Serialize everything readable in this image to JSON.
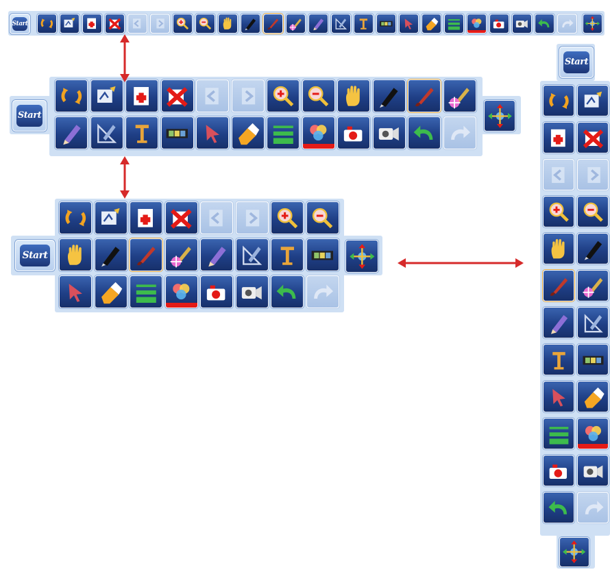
{
  "start_label": "Start",
  "colors": {
    "bar_background": "#cfe0f4",
    "button_dark": "#1f3f86",
    "button_disabled": "#b7cdeb",
    "arrow": "#d62a2a",
    "color_indicator": "#e41b17",
    "selected_border": "#e0a33a"
  },
  "tools": [
    {
      "id": "clear",
      "icon": "circular-arrows-icon"
    },
    {
      "id": "shape-recognition",
      "icon": "pen-draw-icon"
    },
    {
      "id": "new-page",
      "icon": "add-page-icon"
    },
    {
      "id": "delete-page",
      "icon": "delete-page-icon"
    },
    {
      "id": "previous-page",
      "icon": "previous-page-icon",
      "disabled": true
    },
    {
      "id": "next-page",
      "icon": "next-page-icon",
      "disabled": true
    },
    {
      "id": "zoom-in",
      "icon": "zoom-in-icon"
    },
    {
      "id": "zoom-out",
      "icon": "zoom-out-icon"
    },
    {
      "id": "pan",
      "icon": "hand-icon"
    },
    {
      "id": "pen",
      "icon": "pen-icon"
    },
    {
      "id": "brush",
      "icon": "brush-icon",
      "selected": true
    },
    {
      "id": "magic-brush",
      "icon": "magic-brush-icon"
    },
    {
      "id": "pencil",
      "icon": "pencil-icon"
    },
    {
      "id": "ruler-pen",
      "icon": "ruler-pen-icon"
    },
    {
      "id": "text",
      "icon": "text-tool-icon"
    },
    {
      "id": "screen-strip",
      "icon": "film-strip-icon"
    },
    {
      "id": "select",
      "icon": "cursor-arrow-icon"
    },
    {
      "id": "eraser",
      "icon": "eraser-icon"
    },
    {
      "id": "line-width",
      "icon": "line-width-icon"
    },
    {
      "id": "color",
      "icon": "color-palette-icon",
      "indicator": true
    },
    {
      "id": "capture",
      "icon": "camera-capture-icon"
    },
    {
      "id": "record",
      "icon": "video-camera-icon"
    },
    {
      "id": "undo",
      "icon": "undo-icon"
    },
    {
      "id": "redo",
      "icon": "redo-icon",
      "disabled": true
    }
  ],
  "toolbars": [
    {
      "layout": "single-row-horizontal"
    },
    {
      "layout": "two-row-horizontal"
    },
    {
      "layout": "three-row-horizontal"
    },
    {
      "layout": "two-column-vertical"
    }
  ],
  "arrows": [
    {
      "between": [
        "single-row-horizontal",
        "two-row-horizontal"
      ],
      "direction": "vertical"
    },
    {
      "between": [
        "two-row-horizontal",
        "three-row-horizontal"
      ],
      "direction": "vertical"
    },
    {
      "between": [
        "three-row-horizontal",
        "two-column-vertical"
      ],
      "direction": "horizontal"
    }
  ]
}
